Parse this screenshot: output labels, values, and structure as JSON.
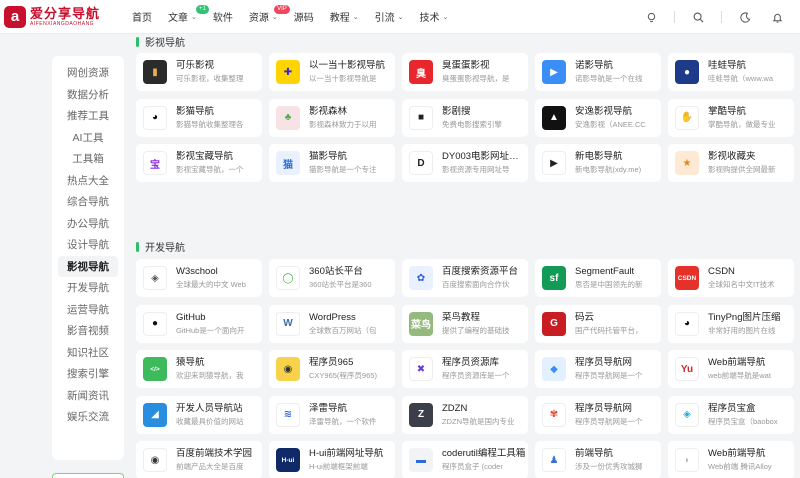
{
  "logo": {
    "mark": "a",
    "title": "爱分享导航",
    "subtitle": "AIFENXIANGDAOHANG"
  },
  "nav": [
    {
      "label": "首页",
      "chevron": false
    },
    {
      "label": "文章",
      "chevron": true,
      "badge": "+1",
      "badge_color": "green"
    },
    {
      "label": "软件",
      "chevron": false
    },
    {
      "label": "资源",
      "chevron": true,
      "badge": "VIP",
      "badge_color": "red"
    },
    {
      "label": "源码",
      "chevron": false
    },
    {
      "label": "教程",
      "chevron": true
    },
    {
      "label": "引流",
      "chevron": true
    },
    {
      "label": "技术",
      "chevron": true
    }
  ],
  "header_icons": [
    "bulb-icon",
    "search-icon",
    "moon-icon",
    "bell-icon"
  ],
  "sidebar": {
    "items": [
      "网创资源",
      "数据分析",
      "推荐工具",
      "AI工具",
      "工具箱",
      "热点大全",
      "综合导航",
      "办公导航",
      "设计导航",
      "影视导航",
      "开发导航",
      "运营导航",
      "影音视频",
      "知识社区",
      "搜索引擎",
      "新闻资讯",
      "娱乐交流"
    ],
    "active_index": 9
  },
  "sections": [
    {
      "title": "影视导航",
      "cards": [
        {
          "title": "可乐影视",
          "desc": "可乐影视，收集整理",
          "icon": "cola-icon",
          "glyph": "▮",
          "bg": "#2b2b2b",
          "fg": "#e8b04a"
        },
        {
          "title": "以一当十影视导航",
          "desc": "以一当十影视导航是",
          "icon": "plus-icon",
          "glyph": "✚",
          "bg": "#ffd400",
          "fg": "#3a2ac8"
        },
        {
          "title": "臭蛋蛋影视",
          "desc": "臭蛋蛋影视导航，是",
          "icon": "chou-icon",
          "glyph": "臭",
          "bg": "#e8262d",
          "fg": "#ffffff"
        },
        {
          "title": "诺影导航",
          "desc": "诺影导航是一个在线",
          "icon": "play-icon",
          "glyph": "▶",
          "bg": "#3a8ef5",
          "fg": "#ffffff"
        },
        {
          "title": "哇蛙导航",
          "desc": "哇蛙导航（www.wa",
          "icon": "frog-icon",
          "glyph": "●",
          "bg": "#1e3b8a",
          "fg": "#ffffff"
        },
        {
          "title": "影猫导航",
          "desc": "影猫导航收集整理各",
          "icon": "panda-icon",
          "glyph": "◕",
          "bg": "#ffffff",
          "fg": "#111111"
        },
        {
          "title": "影视森林",
          "desc": "影视森林致力于以用",
          "icon": "forest-icon",
          "glyph": "♣",
          "bg": "#f7e2e6",
          "fg": "#4caf50"
        },
        {
          "title": "影剧搜",
          "desc": "免费电影搜索引擎",
          "icon": "camera-icon",
          "glyph": "■",
          "bg": "#ffffff",
          "fg": "#222222"
        },
        {
          "title": "安逸影视导航",
          "desc": "安逸影视（ANEE.CC",
          "icon": "anee-icon",
          "glyph": "▲",
          "bg": "#111111",
          "fg": "#ffffff"
        },
        {
          "title": "掌酷导航",
          "desc": "掌酷导航，做最专业",
          "icon": "hand-icon",
          "glyph": "✋",
          "bg": "#ffffff",
          "fg": "#2a4bd8"
        },
        {
          "title": "影视宝藏导航",
          "desc": "影视宝藏导航，一个",
          "icon": "bao-icon",
          "glyph": "宝",
          "bg": "#ffffff",
          "fg": "#8e2ad8"
        },
        {
          "title": "猫影导航",
          "desc": "猫影导航是一个专注",
          "icon": "cat-icon",
          "glyph": "猫",
          "bg": "#e9f1ff",
          "fg": "#2a6cd8"
        },
        {
          "title": "DY003电影网址导航",
          "desc": "影视资源专用网址导",
          "icon": "dy-icon",
          "glyph": "D",
          "bg": "#ffffff",
          "fg": "#222222"
        },
        {
          "title": "新电影导航",
          "desc": "新电影导航(xdy.me)",
          "icon": "window-icon",
          "glyph": "▶",
          "bg": "#ffffff",
          "fg": "#222222"
        },
        {
          "title": "影视收藏夹",
          "desc": "影视购提供全网最新",
          "icon": "bookmark-icon",
          "glyph": "★",
          "bg": "#fde9d4",
          "fg": "#e08a1e"
        },
        {
          "title": "影视收藏夹",
          "desc": "影视购提供全网最新",
          "icon": "bookmark-icon",
          "glyph": "★",
          "bg": "#fde9d4",
          "fg": "#e08a1e"
        }
      ]
    },
    {
      "title": "开发导航",
      "cards": [
        {
          "title": "W3school",
          "desc": "全球最大的中文 Web",
          "icon": "w3school-icon",
          "glyph": "◈",
          "bg": "#ffffff",
          "fg": "#555555"
        },
        {
          "title": "360站长平台",
          "desc": "360站长平台是360",
          "icon": "360-icon",
          "glyph": "◯",
          "bg": "#ffffff",
          "fg": "#3cb043"
        },
        {
          "title": "百度搜索资源平台",
          "desc": "百度搜索面向合作伙",
          "icon": "baidu-paw-icon",
          "glyph": "✿",
          "bg": "#e9f0ff",
          "fg": "#2a5cd8"
        },
        {
          "title": "SegmentFault",
          "desc": "思否是中国领先的新",
          "icon": "sf-icon",
          "glyph": "sf",
          "bg": "#129b56",
          "fg": "#ffffff"
        },
        {
          "title": "CSDN",
          "desc": "全球知名中文IT技术",
          "icon": "csdn-icon",
          "glyph": "CSDN",
          "bg": "#e4322b",
          "fg": "#ffffff"
        },
        {
          "title": "GitHub",
          "desc": "GitHub是一个面向开",
          "icon": "github-icon",
          "glyph": "●",
          "bg": "#ffffff",
          "fg": "#111111"
        },
        {
          "title": "WordPress",
          "desc": "全球数百万网站（包",
          "icon": "wordpress-icon",
          "glyph": "W",
          "bg": "#ffffff",
          "fg": "#3d6fa3"
        },
        {
          "title": "菜鸟教程",
          "desc": "提供了编程的基础技",
          "icon": "runoob-icon",
          "glyph": "菜鸟",
          "bg": "#96b97d",
          "fg": "#ffffff"
        },
        {
          "title": "码云",
          "desc": "国产代码托管平台，",
          "icon": "gitee-icon",
          "glyph": "G",
          "bg": "#c71d23",
          "fg": "#ffffff"
        },
        {
          "title": "TinyPng图片压缩",
          "desc": "非常好用的图片在线",
          "icon": "panda-icon",
          "glyph": "◕",
          "bg": "#ffffff",
          "fg": "#111111"
        },
        {
          "title": "猿导航",
          "desc": "欢迎来到猿导航，我",
          "icon": "code-bubble-icon",
          "glyph": "</>",
          "bg": "#3dbb5c",
          "fg": "#ffffff"
        },
        {
          "title": "程序员965",
          "desc": "CXY965(程序员965)",
          "icon": "monkey-icon",
          "glyph": "◉",
          "bg": "#f7d24a",
          "fg": "#333333"
        },
        {
          "title": "程序员资源库",
          "desc": "程序员资源库是一个",
          "icon": "cross-icon",
          "glyph": "✖",
          "bg": "#ffffff",
          "fg": "#6c3ad8"
        },
        {
          "title": "程序员导航网",
          "desc": "程序员导航网是一个",
          "icon": "cube-icon",
          "glyph": "◆",
          "bg": "#e3f0ff",
          "fg": "#3a8ef5"
        },
        {
          "title": "Web前端导航",
          "desc": "web前端导航是wat",
          "icon": "yu-icon",
          "glyph": "Yu",
          "bg": "#ffffff",
          "fg": "#d6262d"
        },
        {
          "title": "开发人员导航站",
          "desc": "收藏最具价值的网站",
          "icon": "devnav-icon",
          "glyph": "◢",
          "bg": "#2a8ee0",
          "fg": "#ffffff"
        },
        {
          "title": "泽雷导航",
          "desc": "泽雷导航，一个软件",
          "icon": "z-icon",
          "glyph": "≋",
          "bg": "#ffffff",
          "fg": "#2a6cd8"
        },
        {
          "title": "ZDZN",
          "desc": "ZDZN导航是国内专业",
          "icon": "zdzn-icon",
          "glyph": "Z",
          "bg": "#3a3f4a",
          "fg": "#ffffff"
        },
        {
          "title": "程序员导航网",
          "desc": "程序员导航网是一个",
          "icon": "flower-icon",
          "glyph": "✾",
          "bg": "#ffffff",
          "fg": "#e0442a"
        },
        {
          "title": "程序员宝盒",
          "desc": "程序员宝盒（baobox",
          "icon": "box-icon",
          "glyph": "◈",
          "bg": "#ffffff",
          "fg": "#2aa7d8"
        },
        {
          "title": "百度前端技术学园",
          "desc": "前端产品大全是百度",
          "icon": "baidu-fe-icon",
          "glyph": "◉",
          "bg": "#ffffff",
          "fg": "#333333"
        },
        {
          "title": "H-ui前端网址导航",
          "desc": "H-ui前端框架前端",
          "icon": "hui-icon",
          "glyph": "H-ui",
          "bg": "#0f2a66",
          "fg": "#ffffff"
        },
        {
          "title": "coderutil编程工具箱",
          "desc": "程序员盒子 (coder",
          "icon": "coderutil-icon",
          "glyph": "▬",
          "bg": "#f1f3f5",
          "fg": "#2a6cd8"
        },
        {
          "title": "前端导航",
          "desc": "涉及一份优秀攻城狮",
          "icon": "people-icon",
          "glyph": "♟",
          "bg": "#ffffff",
          "fg": "#3a6fd8"
        },
        {
          "title": "Web前端导航",
          "desc": "Web前端 腾讯Alloy",
          "icon": "ghost-icon",
          "glyph": "◗",
          "bg": "#ffffff",
          "fg": "#bbbbbb"
        }
      ]
    }
  ]
}
